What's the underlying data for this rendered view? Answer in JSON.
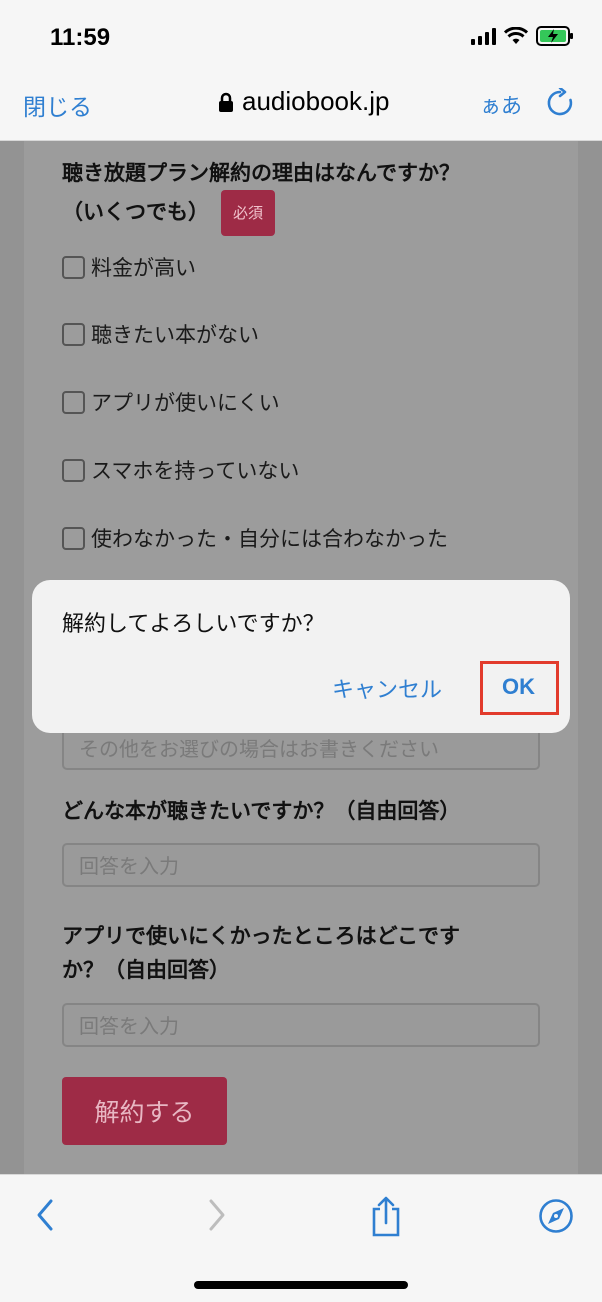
{
  "status_bar": {
    "time": "11:59"
  },
  "browser": {
    "close_label": "閉じる",
    "url": "audiobook.jp",
    "text_size_label": "ぁあ"
  },
  "form": {
    "question1": "聴き放題プラン解約の理由はなんですか？",
    "question1_line2": "（いくつでも）",
    "required_badge": "必須",
    "options": [
      "料金が高い",
      "聴きたい本がない",
      "アプリが使いにくい",
      "スマホを持っていない",
      "使わなかった・自分には合わなかった"
    ],
    "other_placeholder": "その他をお選びの場合はお書きください",
    "question2": "どんな本が聴きたいですか？（自由回答）",
    "answer_placeholder": "回答を入力",
    "question3_line1": "アプリで使いにくかったところはどこです",
    "question3_line2": "か？（自由回答）",
    "submit_label": "解約する"
  },
  "dialog": {
    "message": "解約してよろしいですか？",
    "cancel_label": "キャンセル",
    "ok_label": "OK",
    "highlight_color": "#e23b2c"
  },
  "colors": {
    "accent": "#2f7fd1",
    "brand": "#9e2b46"
  }
}
